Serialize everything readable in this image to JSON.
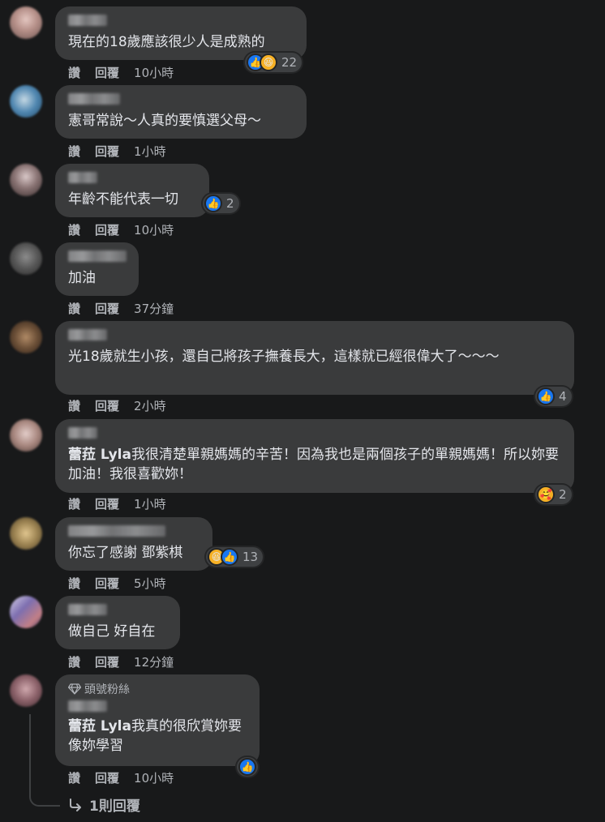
{
  "labels": {
    "like": "讚",
    "reply": "回覆"
  },
  "comments": [
    {
      "text": "現在的18歲應該很少人是成熟的",
      "time": "10小時",
      "reactions": [
        "like-icon",
        "haha-icon"
      ],
      "reaction_count": "22",
      "avatar_colors": [
        "#c9a9a3",
        "#8a6d68"
      ]
    },
    {
      "text": "憲哥常說～人真的要慎選父母～",
      "time": "1小時",
      "reactions": [],
      "reaction_count": "",
      "avatar_colors": [
        "#3a6f9a",
        "#b8d0dd"
      ]
    },
    {
      "text": "年齡不能代表一切",
      "time": "10小時",
      "reactions": [
        "like-icon"
      ],
      "reaction_count": "2",
      "avatar_colors": [
        "#a89696",
        "#4a3d3d"
      ]
    },
    {
      "text": "加油",
      "time": "37分鐘",
      "reactions": [],
      "reaction_count": "",
      "avatar_colors": [
        "#6c6c6c",
        "#3d3d3d"
      ]
    },
    {
      "text": "光18歲就生小孩，還自己將孩子撫養長大，這樣就已經很偉大了～～～",
      "time": "2小時",
      "reactions": [
        "like-icon"
      ],
      "reaction_count": "4",
      "avatar_colors": [
        "#8c6a4f",
        "#3a2d22"
      ]
    },
    {
      "tag": "蕾菈 Lyla",
      "text": "我很清楚單親媽媽的辛苦！因為我也是兩個孩子的單親媽媽！所以妳要加油！我很喜歡妳！",
      "time": "1小時",
      "reactions": [
        "care-icon"
      ],
      "reaction_count": "2",
      "avatar_colors": [
        "#c3a6a0",
        "#6c5552"
      ]
    },
    {
      "text": "你忘了感謝 鄧紫棋",
      "time": "5小時",
      "reactions": [
        "haha-icon",
        "like-icon"
      ],
      "reaction_count": "13",
      "avatar_colors": [
        "#c9b07a",
        "#6b5a3a"
      ]
    },
    {
      "text": "做自己 好自在",
      "time": "12分鐘",
      "reactions": [],
      "reaction_count": "",
      "avatar_colors": [
        "#8a7fb0",
        "#c98a8a"
      ]
    },
    {
      "badge": "頭號粉絲",
      "tag": "蕾菈 Lyla",
      "text": "我真的很欣賞妳要像妳學習",
      "time": "10小時",
      "reactions": [
        "like-icon"
      ],
      "reaction_count": "",
      "avatar_colors": [
        "#a8848a",
        "#4d3a3e"
      ]
    }
  ],
  "replies_link": "1則回覆"
}
